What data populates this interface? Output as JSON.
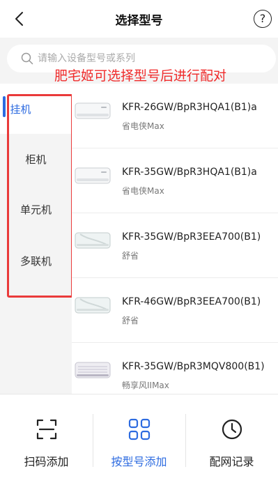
{
  "header": {
    "title": "选择型号",
    "help_glyph": "?"
  },
  "search": {
    "placeholder": "请输入设备型号或系列"
  },
  "annotation": "肥宅姬可选择型号后进行配对",
  "sidebar": {
    "items": [
      {
        "label": "挂机",
        "active": true
      },
      {
        "label": "柜机",
        "active": false
      },
      {
        "label": "单元机",
        "active": false
      },
      {
        "label": "多联机",
        "active": false
      }
    ]
  },
  "products": [
    {
      "model": "KFR-26GW/BpR3HQA1(B1)a",
      "series": "省电侠Max"
    },
    {
      "model": "KFR-35GW/BpR3HQA1(B1)a",
      "series": "省电侠Max"
    },
    {
      "model": "KFR-35GW/BpR3EEA700(B1)",
      "series": "舒省"
    },
    {
      "model": "KFR-46GW/BpR3EEA700(B1)",
      "series": "舒省"
    },
    {
      "model": "KFR-35GW/BpR3MQV800(B1)",
      "series": "畅享风IIMax"
    }
  ],
  "bottom_tabs": [
    {
      "label": "扫码添加",
      "icon": "scan-icon",
      "active": false
    },
    {
      "label": "按型号添加",
      "icon": "grid-icon",
      "active": true
    },
    {
      "label": "配网记录",
      "icon": "clock-icon",
      "active": false
    }
  ],
  "colors": {
    "accent": "#2d6be0",
    "annotation": "#f02b2b",
    "highlight_box": "#ea3a3a",
    "panel_bg": "#f4f4f4"
  }
}
